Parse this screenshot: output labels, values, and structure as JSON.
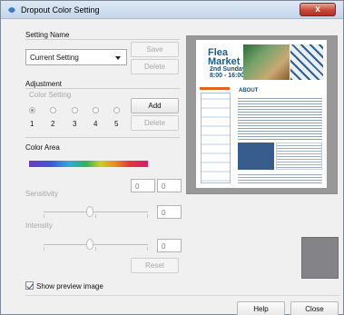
{
  "window": {
    "title": "Dropout Color Setting",
    "close_label": "x"
  },
  "setting_name": {
    "heading": "Setting Name",
    "current_value": "Current Setting",
    "save_label": "Save",
    "delete_label": "Delete"
  },
  "adjustment": {
    "heading": "Adjustment",
    "color_setting_label": "Color Setting",
    "radio_numbers": [
      "1",
      "2",
      "3",
      "4",
      "5"
    ],
    "selected_index": 0,
    "add_label": "Add",
    "delete_label": "Delete"
  },
  "color_area": {
    "heading": "Color Area",
    "field_left_value": "0",
    "field_right_value": "0"
  },
  "sensitivity": {
    "label": "Sensitivity",
    "value": "0"
  },
  "intensity": {
    "label": "Intensity",
    "value": "0"
  },
  "reset_label": "Reset",
  "preview": {
    "doc_title_line1": "Flea",
    "doc_title_line2": "Market",
    "doc_date_line1": "2nd Sunday",
    "doc_date_line2": "8:00 - 16:00",
    "doc_about": "ABOUT",
    "swatch_color": "#848488"
  },
  "show_preview": {
    "label": "Show preview image",
    "checked": true
  },
  "footer": {
    "help_label": "Help",
    "close_label": "Close"
  }
}
